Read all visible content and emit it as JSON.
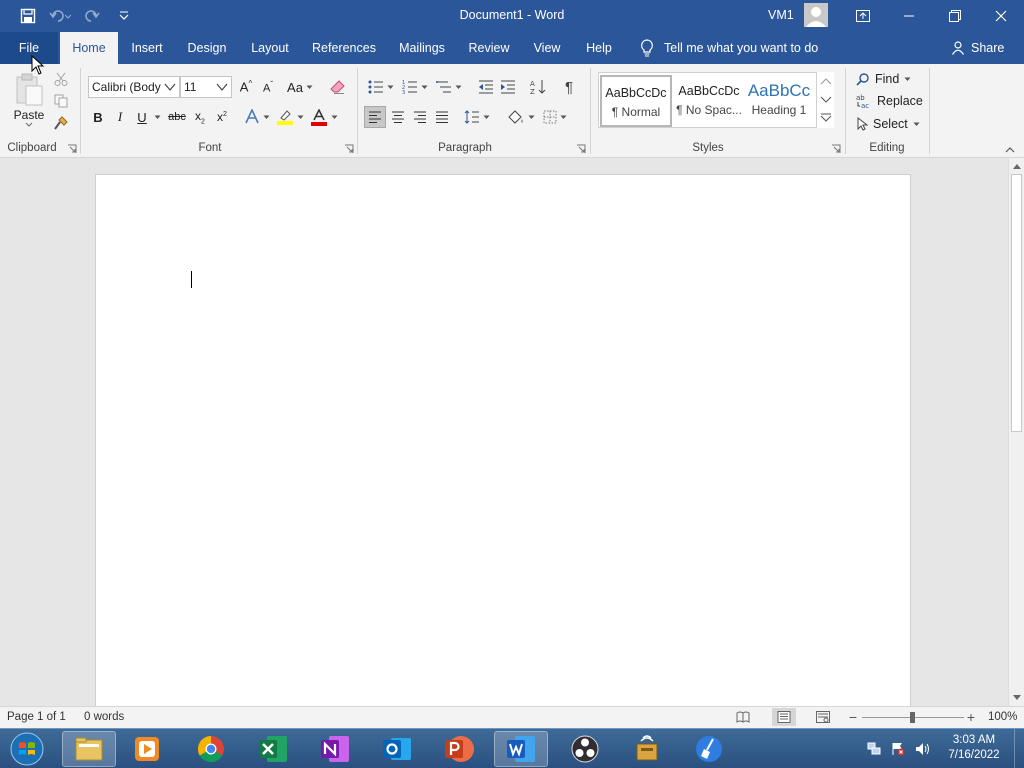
{
  "titlebar": {
    "title": "Document1  -  Word",
    "user": "VM1"
  },
  "ribbon_tabs": {
    "file": "File",
    "home": "Home",
    "insert": "Insert",
    "design": "Design",
    "layout": "Layout",
    "references": "References",
    "mailings": "Mailings",
    "review": "Review",
    "view": "View",
    "help": "Help",
    "tell_me": "Tell me what you want to do",
    "share": "Share"
  },
  "clipboard": {
    "paste_label": "Paste",
    "group_label": "Clipboard"
  },
  "font": {
    "family_value": "Calibri (Body",
    "size_value": "11",
    "change_case": "Aa",
    "bold": "B",
    "italic": "I",
    "underline": "U",
    "strikethrough": "abc",
    "group_label": "Font",
    "highlight_color": "#ffff00",
    "font_color": "#e00000"
  },
  "paragraph": {
    "group_label": "Paragraph"
  },
  "styles": {
    "items": [
      {
        "preview": "AaBbCcDc",
        "label": "¶ Normal"
      },
      {
        "preview": "AaBbCcDc",
        "label": "¶ No Spac..."
      },
      {
        "preview": "AaBbCc",
        "label": "Heading 1"
      }
    ],
    "group_label": "Styles",
    "heading_color": "#2e74b5"
  },
  "editing": {
    "find": "Find",
    "replace": "Replace",
    "select": "Select",
    "group_label": "Editing"
  },
  "statusbar": {
    "page": "Page 1 of 1",
    "words": "0 words",
    "zoom": "100%",
    "zoom_level": 1.0
  },
  "taskbar": {
    "time": "3:03 AM",
    "date": "7/16/2022"
  },
  "colors": {
    "word_blue": "#2b579a",
    "ribbon_bg": "#f3f3f3"
  }
}
